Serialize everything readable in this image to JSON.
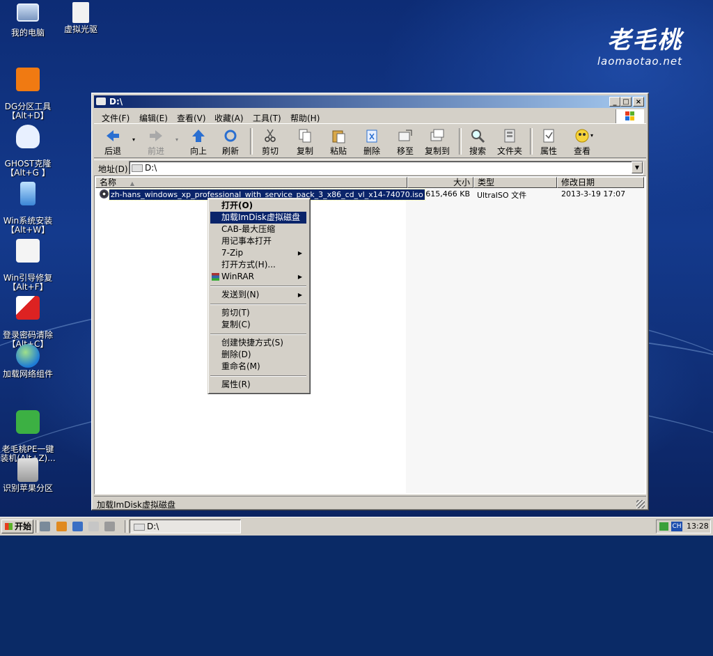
{
  "desktop": {
    "logo": {
      "cn": "老毛桃",
      "en": "laomaotao.net"
    },
    "icons": [
      {
        "label": "我的电脑"
      },
      {
        "label": "虚拟光驱"
      },
      {
        "label": "DG分区工具\n【Alt+D】"
      },
      {
        "label": "GHOST克隆\n【Alt+G 】"
      },
      {
        "label": "Win系统安装\n【Alt+W】"
      },
      {
        "label": "Win引导修复\n【Alt+F】"
      },
      {
        "label": "登录密码清除\n【Alt+C】"
      },
      {
        "label": "加载网络组件"
      },
      {
        "label": "老毛桃PE一键\n装机(Alt+Z)..."
      },
      {
        "label": "识别苹果分区"
      }
    ]
  },
  "window": {
    "title": "D:\\",
    "menu": [
      "文件(F)",
      "编辑(E)",
      "查看(V)",
      "收藏(A)",
      "工具(T)",
      "帮助(H)"
    ],
    "toolbar": [
      "后退",
      "前进",
      "向上",
      "刷新",
      "剪切",
      "复制",
      "粘贴",
      "删除",
      "移至",
      "复制到",
      "搜索",
      "文件夹",
      "属性",
      "查看"
    ],
    "address": {
      "label": "地址(D)",
      "value": "D:\\"
    },
    "columns": [
      "名称",
      "大小",
      "类型",
      "修改日期"
    ],
    "file": {
      "name": "zh-hans_windows_xp_professional_with_service_pack_3_x86_cd_vl_x14-74070.iso",
      "size": "615,466 KB",
      "type": "UltraISO 文件",
      "date": "2013-3-19 17:07"
    },
    "status": "加载ImDisk虚拟磁盘"
  },
  "context_menu": {
    "items": [
      "打开(O)",
      "加载ImDisk虚拟磁盘",
      "CAB-最大压缩",
      "用记事本打开",
      "7-Zip",
      "打开方式(H)...",
      "WinRAR",
      "发送到(N)",
      "剪切(T)",
      "复制(C)",
      "创建快捷方式(S)",
      "删除(D)",
      "重命名(M)",
      "属性(R)"
    ]
  },
  "taskbar": {
    "start": "开始",
    "task": "D:\\",
    "ime": "CH",
    "clock": "13:28"
  }
}
